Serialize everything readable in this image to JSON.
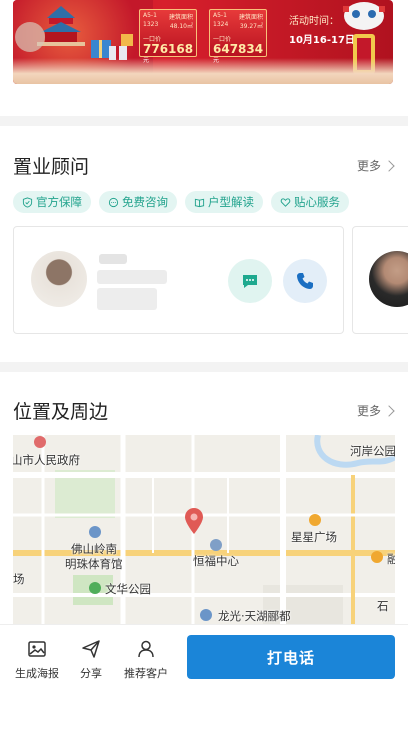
{
  "banner": {
    "cards": [
      {
        "top_left": "A5-1",
        "top_right": "建筑面积",
        "floor": "1323",
        "area": "48.10㎡",
        "price_label": "一口价",
        "price": "776168",
        "unit": "元"
      },
      {
        "top_left": "A5-1",
        "top_right": "建筑面积",
        "floor": "1324",
        "area": "39.27㎡",
        "price_label": "一口价",
        "price": "647834",
        "unit": "元"
      }
    ],
    "activity_label": "活动时间：",
    "activity_dates": "10月16-17日"
  },
  "consultant": {
    "title": "置业顾问",
    "more": "更多",
    "tags": [
      "官方保障",
      "免费咨询",
      "户型解读",
      "贴心服务"
    ]
  },
  "location": {
    "title": "位置及周边",
    "more": "更多",
    "map_labels": [
      "山市人民政府",
      "河岸公园",
      "佛山岭南",
      "明珠体育馆",
      "星星广场",
      "恒福中心",
      "文华公园",
      "龙光·天湖郦都",
      "场",
      "石",
      "融"
    ]
  },
  "bottom_bar": {
    "poster": "生成海报",
    "share": "分享",
    "recommend": "推荐客户",
    "call": "打电话"
  },
  "colors": {
    "accent_blue": "#1b85d8",
    "tag_green": "#22a38d",
    "banner_red": "#c3182a"
  }
}
